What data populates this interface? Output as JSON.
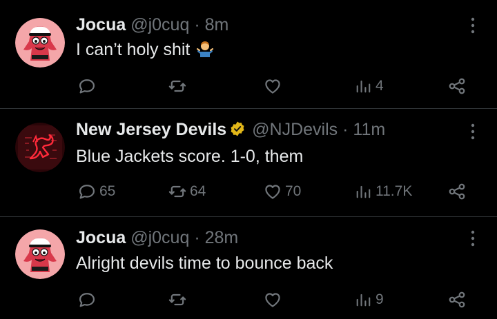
{
  "colors": {
    "background": "#000000",
    "text_primary": "#e7e9ea",
    "text_secondary": "#71767b",
    "divider": "#2f3336",
    "verified_gold": "#e2b719",
    "devils_red": "#ce1126"
  },
  "tweets": [
    {
      "author": {
        "display_name": "Jocua",
        "handle": "@j0cuq",
        "verified": false
      },
      "time": "8m",
      "separator": "·",
      "text": "I can’t holy shit",
      "emoji": "person-shrugging-emoji",
      "avatar_icon": "patrick-star-avatar",
      "actions": {
        "reply": "",
        "retweet": "",
        "like": "",
        "views": "4"
      }
    },
    {
      "author": {
        "display_name": "New Jersey Devils",
        "handle": "@NJDevils",
        "verified": true
      },
      "time": "11m",
      "separator": "·",
      "text": "Blue Jackets score. 1-0, them",
      "avatar_icon": "nj-devils-logo-avatar",
      "actions": {
        "reply": "65",
        "retweet": "64",
        "like": "70",
        "views": "11.7K"
      }
    },
    {
      "author": {
        "display_name": "Jocua",
        "handle": "@j0cuq",
        "verified": false
      },
      "time": "28m",
      "separator": "·",
      "text": "Alright devils time to bounce back",
      "avatar_icon": "patrick-star-avatar",
      "actions": {
        "reply": "",
        "retweet": "",
        "like": "",
        "views": "9"
      }
    }
  ]
}
